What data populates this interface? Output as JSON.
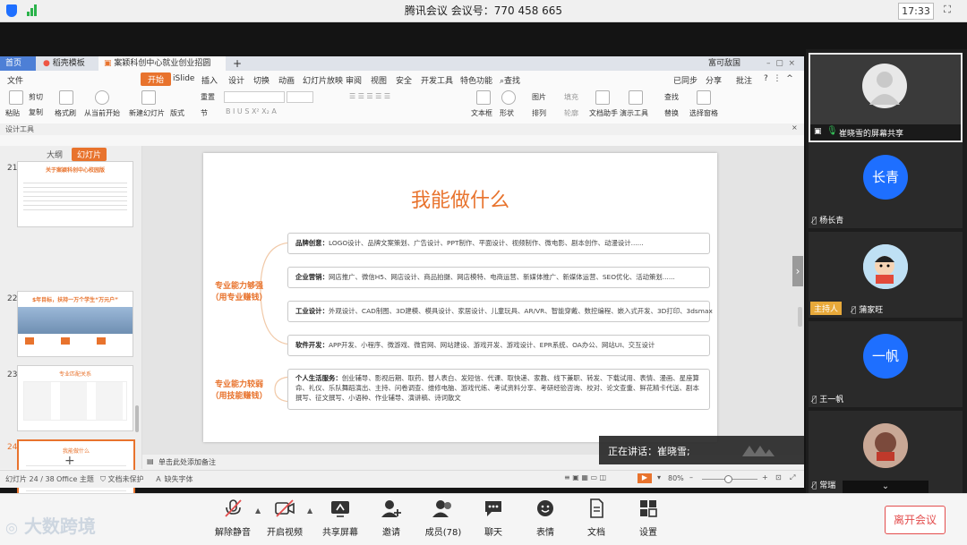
{
  "meeting": {
    "title": "腾讯会议 会议号：770 458 665",
    "clock": "17:33"
  },
  "ppt": {
    "tabs": [
      "首页",
      "稻壳模板",
      "案颖科创中心就业创业招圆5.6.pptx"
    ],
    "menu": [
      "文件",
      "开始",
      "iSlide",
      "插入",
      "设计",
      "切换",
      "动画",
      "幻灯片放映",
      "审阅",
      "视图",
      "安全",
      "开发工具",
      "特色功能",
      "查找"
    ],
    "menu_right": [
      "已同步",
      "分享",
      "批注"
    ],
    "user": "富可敌国",
    "ribbon": [
      "粘贴",
      "剪切",
      "复制",
      "格式刷",
      "从当前开始",
      "新建幻灯片",
      "版式",
      "节",
      "重置",
      "文本框",
      "形状",
      "排列",
      "轮廓",
      "文档助手",
      "演示工具",
      "替换",
      "选择窗格",
      "图片",
      "填充",
      "查找"
    ],
    "design_tools": "设计工具",
    "panel_tabs": [
      "大纲",
      "幻灯片"
    ],
    "thumbnails": [
      {
        "num": "21",
        "title": "关于案颖科创中心校园版"
      },
      {
        "num": "22",
        "title": "$年目标，扶持一万个学生“万元户”"
      },
      {
        "num": "23",
        "title": "专业匹配关系"
      },
      {
        "num": "24",
        "title": "我能做什么"
      }
    ],
    "notes_placeholder": "单击此处添加备注",
    "status": {
      "slide_counter": "幻灯片 24 / 38",
      "theme": "Office 主题",
      "protect": "文档未保护",
      "font_missing": "缺失字体",
      "zoom": "80%"
    }
  },
  "slide": {
    "title": "我能做什么",
    "strong_label": [
      "专业能力够强",
      "（用专业赚钱）"
    ],
    "weak_label": [
      "专业能力较弱",
      "（用技能赚钱）"
    ],
    "items": [
      {
        "head": "品牌创意：",
        "text": "LOGO设计、品牌文案策划、广告设计、PPT制作、平面设计、视频制作、微电影、剧本创作、动漫设计......"
      },
      {
        "head": "企业营销：",
        "text": "网店推广、微信H5、网店设计、商品拍摄、网店模特、电商运营、新媒体推广、新媒体运营、SEO优化、活动策划......"
      },
      {
        "head": "工业设计：",
        "text": "外观设计、CAD制图、3D建模、模具设计、家居设计、儿童玩具、AR/VR、智能穿戴、数控编程、嵌入式开发、3D打印、3dsmax"
      },
      {
        "head": "软件开发：",
        "text": "APP开发、小程序、微游戏、微官网、网站建设、游戏开发、游戏设计、EPR系统、OA办公、网站UI、交互设计"
      }
    ],
    "life": {
      "head": "个人生活服务：",
      "text": "创业辅导、影视后期、取药、替人表白、发短信、代课、取快递、家教、线下兼职、转发、下载试用、表情、漫画、星座算命、礼仪、乐队舞蹈演出、主持、问卷调查、维修电脑、游戏代练、考试资料分享、考研经验咨询、校对、论文查重、鲜花精卡代送、剧本撰写、征文撰写、小语种、作业辅导、演讲稿、诗词散文"
    }
  },
  "speaking": "正在讲话：崔晓雪;",
  "participants": [
    {
      "name": "崔晓雪的屏幕共享",
      "avatar_text": "",
      "host": false
    },
    {
      "name": "杨长青",
      "avatar_text": "长青",
      "host": false
    },
    {
      "name": "蒲家旺",
      "avatar_text": "",
      "host": true,
      "host_label": "主持人"
    },
    {
      "name": "王一帆",
      "avatar_text": "一帆",
      "host": false
    },
    {
      "name": "常瑞",
      "avatar_text": "",
      "host": false
    }
  ],
  "toolbar": {
    "unmute": "解除静音",
    "video": "开启视频",
    "share": "共享屏幕",
    "invite": "邀请",
    "members": "成员(78)",
    "chat": "聊天",
    "emoji": "表情",
    "docs": "文档",
    "settings": "设置",
    "leave": "离开会议"
  },
  "watermark": "大数跨境",
  "colors": {
    "accent": "#e8732d",
    "tencent_blue": "#1e6fff",
    "leave_red": "#e34d4d"
  }
}
